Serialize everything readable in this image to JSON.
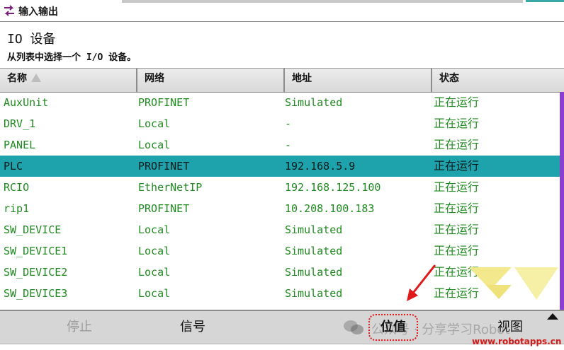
{
  "window": {
    "title": "输入输出"
  },
  "header": {
    "title": "IO 设备",
    "subtitle": "从列表中选择一个 I/O 设备。"
  },
  "table": {
    "columns": [
      "名称",
      "网络",
      "地址",
      "状态"
    ],
    "rows": [
      {
        "name": "AuxUnit",
        "network": "PROFINET",
        "address": "Simulated",
        "state": "正在运行"
      },
      {
        "name": "DRV_1",
        "network": "Local",
        "address": "-",
        "state": "正在运行"
      },
      {
        "name": "PANEL",
        "network": "Local",
        "address": "-",
        "state": "正在运行"
      },
      {
        "name": "PLC",
        "network": "PROFINET",
        "address": "192.168.5.9",
        "state": "正在运行",
        "selected": true
      },
      {
        "name": "RCIO",
        "network": "EtherNetIP",
        "address": "192.168.125.100",
        "state": "正在运行"
      },
      {
        "name": "rip1",
        "network": "PROFINET",
        "address": "10.208.100.183",
        "state": "正在运行"
      },
      {
        "name": "SW_DEVICE",
        "network": "Local",
        "address": "Simulated",
        "state": "正在运行"
      },
      {
        "name": "SW_DEVICE1",
        "network": "Local",
        "address": "Simulated",
        "state": "正在运行"
      },
      {
        "name": "SW_DEVICE2",
        "network": "Local",
        "address": "Simulated",
        "state": "正在运行"
      },
      {
        "name": "SW_DEVICE3",
        "network": "Local",
        "address": "Simulated",
        "state": "正在运行"
      }
    ]
  },
  "toolbar": {
    "stop_label": "停止",
    "signal_label": "信号",
    "value_label": "位值",
    "view_label": "视图"
  },
  "watermark": {
    "text": "公众号 · 分享学习Robot",
    "url": "www.robotapps.cn"
  },
  "colors": {
    "selected_row": "#1ea3ad",
    "row_text": "#1f8a1f",
    "scrollbar": "#8a3fd0",
    "highlight_ring": "#e0191a"
  }
}
